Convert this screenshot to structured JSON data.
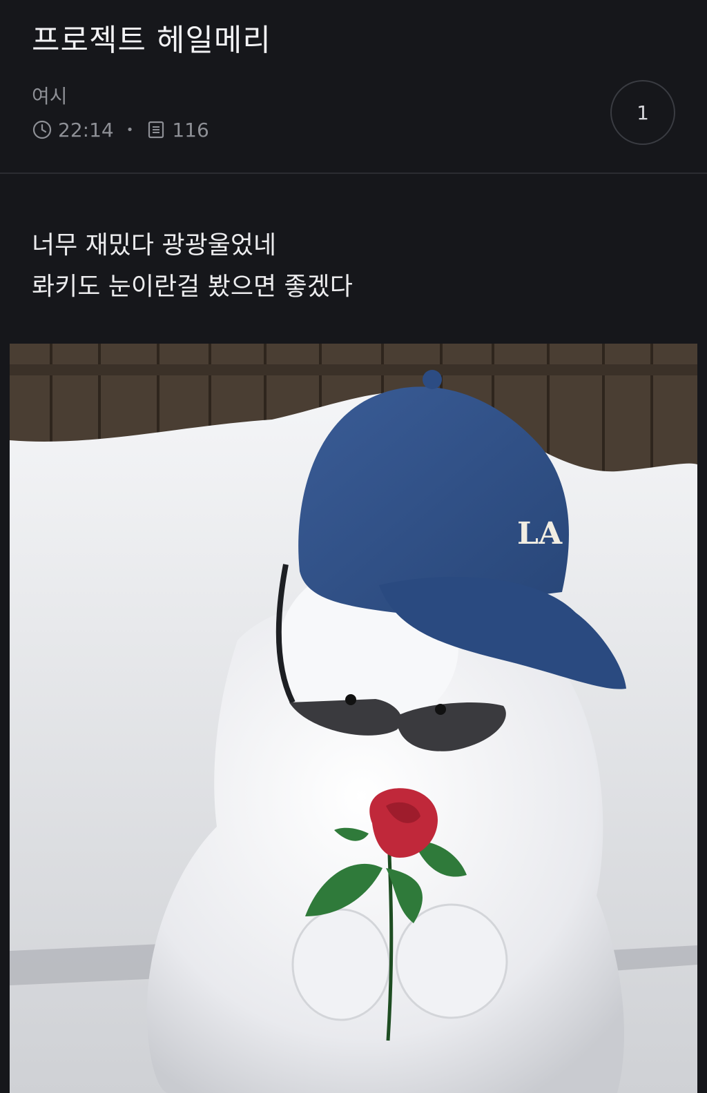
{
  "post": {
    "title": "프로젝트 헤일메리",
    "author": "여시",
    "time": "22:14",
    "views": "116",
    "comment_count": "1",
    "body_lines": [
      "너무 재밌다 광광울었네",
      "롸키도 눈이란걸 봤으면 좋겠다"
    ]
  },
  "photo": {
    "cap_logo": "LA",
    "colors": {
      "cap": "#2f4f86",
      "rose": "#c0283a",
      "leaf": "#2f7a3a",
      "fence": "#4a3e33",
      "snow": "#eeeff2"
    }
  },
  "icons": {
    "time": "clock-icon",
    "views": "document-icon"
  }
}
